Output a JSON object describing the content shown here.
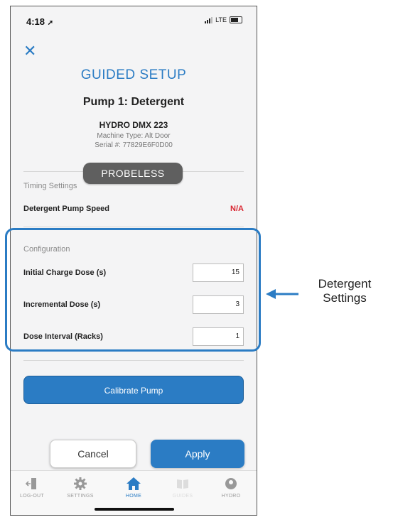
{
  "status": {
    "time": "4:18",
    "network": "LTE"
  },
  "header": {
    "title": "GUIDED SETUP",
    "pump_title": "Pump 1: Detergent",
    "machine_name": "HYDRO DMX 223",
    "machine_type": "Machine Type: Alt Door",
    "serial": "Serial #: 77829E6F0D00"
  },
  "probeless_badge": "PROBELESS",
  "timing": {
    "section_label": "Timing Settings",
    "pump_speed_label": "Detergent Pump Speed",
    "pump_speed_value": "N/A"
  },
  "configuration": {
    "section_label": "Configuration",
    "fields": [
      {
        "label": "Initial Charge Dose (s)",
        "value": "15"
      },
      {
        "label": "Incremental Dose (s)",
        "value": "3"
      },
      {
        "label": "Dose Interval (Racks)",
        "value": "1"
      }
    ]
  },
  "buttons": {
    "calibrate": "Calibrate Pump",
    "cancel": "Cancel",
    "apply": "Apply"
  },
  "tabs": [
    {
      "label": "LOG-OUT",
      "icon": "logout-icon"
    },
    {
      "label": "SETTINGS",
      "icon": "gear-icon"
    },
    {
      "label": "HOME",
      "icon": "home-icon",
      "active": true
    },
    {
      "label": "GUIDES",
      "icon": "book-icon",
      "disabled": true
    },
    {
      "label": "HYDRO",
      "icon": "hydro-icon"
    }
  ],
  "annotation": {
    "line1": "Detergent",
    "line2": "Settings"
  },
  "colors": {
    "accent": "#2b7cc4",
    "na": "#d9242f",
    "badge": "#5f5f5f"
  }
}
